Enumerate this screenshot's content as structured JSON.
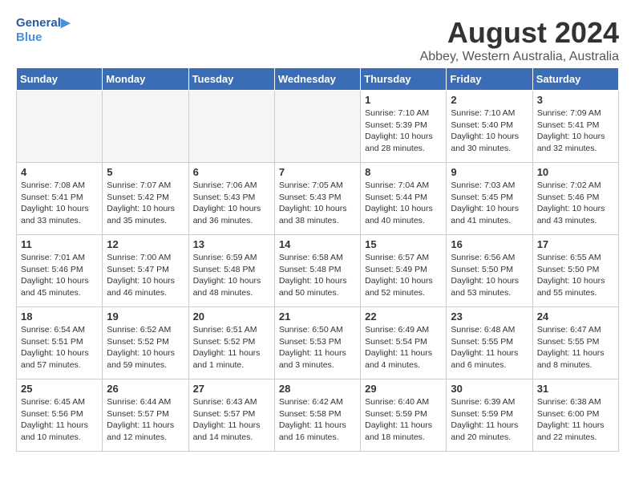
{
  "logo": {
    "line1": "General",
    "line2": "Blue"
  },
  "header": {
    "month_year": "August 2024",
    "location": "Abbey, Western Australia, Australia"
  },
  "weekdays": [
    "Sunday",
    "Monday",
    "Tuesday",
    "Wednesday",
    "Thursday",
    "Friday",
    "Saturday"
  ],
  "weeks": [
    [
      {
        "day": "",
        "info": ""
      },
      {
        "day": "",
        "info": ""
      },
      {
        "day": "",
        "info": ""
      },
      {
        "day": "",
        "info": ""
      },
      {
        "day": "1",
        "info": "Sunrise: 7:10 AM\nSunset: 5:39 PM\nDaylight: 10 hours\nand 28 minutes."
      },
      {
        "day": "2",
        "info": "Sunrise: 7:10 AM\nSunset: 5:40 PM\nDaylight: 10 hours\nand 30 minutes."
      },
      {
        "day": "3",
        "info": "Sunrise: 7:09 AM\nSunset: 5:41 PM\nDaylight: 10 hours\nand 32 minutes."
      }
    ],
    [
      {
        "day": "4",
        "info": "Sunrise: 7:08 AM\nSunset: 5:41 PM\nDaylight: 10 hours\nand 33 minutes."
      },
      {
        "day": "5",
        "info": "Sunrise: 7:07 AM\nSunset: 5:42 PM\nDaylight: 10 hours\nand 35 minutes."
      },
      {
        "day": "6",
        "info": "Sunrise: 7:06 AM\nSunset: 5:43 PM\nDaylight: 10 hours\nand 36 minutes."
      },
      {
        "day": "7",
        "info": "Sunrise: 7:05 AM\nSunset: 5:43 PM\nDaylight: 10 hours\nand 38 minutes."
      },
      {
        "day": "8",
        "info": "Sunrise: 7:04 AM\nSunset: 5:44 PM\nDaylight: 10 hours\nand 40 minutes."
      },
      {
        "day": "9",
        "info": "Sunrise: 7:03 AM\nSunset: 5:45 PM\nDaylight: 10 hours\nand 41 minutes."
      },
      {
        "day": "10",
        "info": "Sunrise: 7:02 AM\nSunset: 5:46 PM\nDaylight: 10 hours\nand 43 minutes."
      }
    ],
    [
      {
        "day": "11",
        "info": "Sunrise: 7:01 AM\nSunset: 5:46 PM\nDaylight: 10 hours\nand 45 minutes."
      },
      {
        "day": "12",
        "info": "Sunrise: 7:00 AM\nSunset: 5:47 PM\nDaylight: 10 hours\nand 46 minutes."
      },
      {
        "day": "13",
        "info": "Sunrise: 6:59 AM\nSunset: 5:48 PM\nDaylight: 10 hours\nand 48 minutes."
      },
      {
        "day": "14",
        "info": "Sunrise: 6:58 AM\nSunset: 5:48 PM\nDaylight: 10 hours\nand 50 minutes."
      },
      {
        "day": "15",
        "info": "Sunrise: 6:57 AM\nSunset: 5:49 PM\nDaylight: 10 hours\nand 52 minutes."
      },
      {
        "day": "16",
        "info": "Sunrise: 6:56 AM\nSunset: 5:50 PM\nDaylight: 10 hours\nand 53 minutes."
      },
      {
        "day": "17",
        "info": "Sunrise: 6:55 AM\nSunset: 5:50 PM\nDaylight: 10 hours\nand 55 minutes."
      }
    ],
    [
      {
        "day": "18",
        "info": "Sunrise: 6:54 AM\nSunset: 5:51 PM\nDaylight: 10 hours\nand 57 minutes."
      },
      {
        "day": "19",
        "info": "Sunrise: 6:52 AM\nSunset: 5:52 PM\nDaylight: 10 hours\nand 59 minutes."
      },
      {
        "day": "20",
        "info": "Sunrise: 6:51 AM\nSunset: 5:52 PM\nDaylight: 11 hours\nand 1 minute."
      },
      {
        "day": "21",
        "info": "Sunrise: 6:50 AM\nSunset: 5:53 PM\nDaylight: 11 hours\nand 3 minutes."
      },
      {
        "day": "22",
        "info": "Sunrise: 6:49 AM\nSunset: 5:54 PM\nDaylight: 11 hours\nand 4 minutes."
      },
      {
        "day": "23",
        "info": "Sunrise: 6:48 AM\nSunset: 5:55 PM\nDaylight: 11 hours\nand 6 minutes."
      },
      {
        "day": "24",
        "info": "Sunrise: 6:47 AM\nSunset: 5:55 PM\nDaylight: 11 hours\nand 8 minutes."
      }
    ],
    [
      {
        "day": "25",
        "info": "Sunrise: 6:45 AM\nSunset: 5:56 PM\nDaylight: 11 hours\nand 10 minutes."
      },
      {
        "day": "26",
        "info": "Sunrise: 6:44 AM\nSunset: 5:57 PM\nDaylight: 11 hours\nand 12 minutes."
      },
      {
        "day": "27",
        "info": "Sunrise: 6:43 AM\nSunset: 5:57 PM\nDaylight: 11 hours\nand 14 minutes."
      },
      {
        "day": "28",
        "info": "Sunrise: 6:42 AM\nSunset: 5:58 PM\nDaylight: 11 hours\nand 16 minutes."
      },
      {
        "day": "29",
        "info": "Sunrise: 6:40 AM\nSunset: 5:59 PM\nDaylight: 11 hours\nand 18 minutes."
      },
      {
        "day": "30",
        "info": "Sunrise: 6:39 AM\nSunset: 5:59 PM\nDaylight: 11 hours\nand 20 minutes."
      },
      {
        "day": "31",
        "info": "Sunrise: 6:38 AM\nSunset: 6:00 PM\nDaylight: 11 hours\nand 22 minutes."
      }
    ]
  ]
}
